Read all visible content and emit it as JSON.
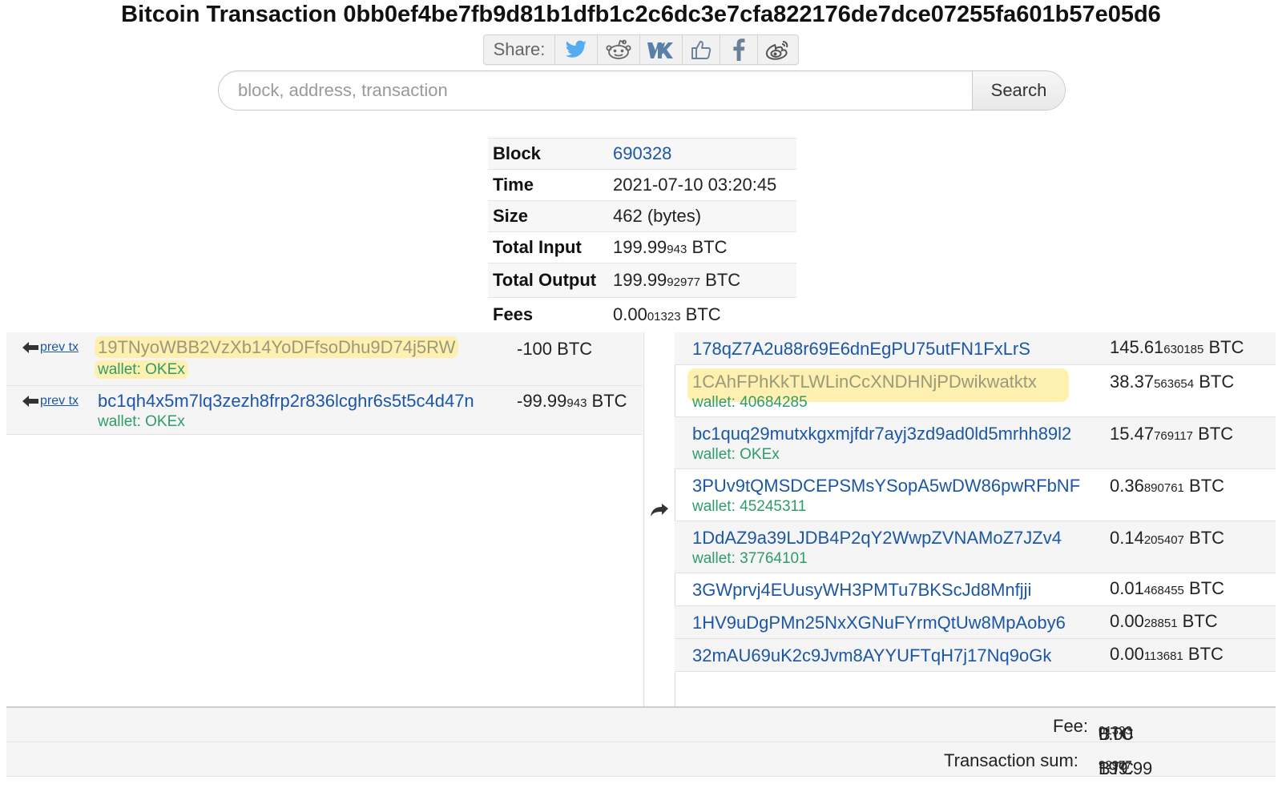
{
  "header": {
    "title": "Bitcoin Transaction 0bb0ef4be7fb9d81b1dfb1c2c6dc3e7cfa822176de7dce07255fa601b57e05d6"
  },
  "share": {
    "label": "Share:",
    "buttons": [
      "twitter-icon",
      "reddit-icon",
      "vk-icon",
      "like-icon",
      "facebook-icon",
      "weibo-icon"
    ]
  },
  "search": {
    "placeholder": "block, address, transaction",
    "button_label": "Search"
  },
  "summary": {
    "block_label": "Block",
    "block_value": "690328",
    "time_label": "Time",
    "time_value": "2021-07-10 03:20:45",
    "size_label": "Size",
    "size_value": "462 (bytes)",
    "total_input_label": "Total Input",
    "total_input_main": "199.99",
    "total_input_small": "943",
    "total_output_label": "Total Output",
    "total_output_main": "199.99",
    "total_output_small": "92977",
    "fees_label": "Fees",
    "fees_main": "0.00",
    "fees_small": "01323",
    "unit": "BTC"
  },
  "inputs": [
    {
      "prev_label": "prev tx",
      "address": "19TNyoWBB2VzXb14YoDFfsoDhu9D74j5RW",
      "wallet": "wallet: OKEx",
      "amount_main": "-100",
      "amount_small": "",
      "unit": "BTC"
    },
    {
      "prev_label": "prev tx",
      "address": "bc1qh4x5m7lq3zezh8frp2r836lcghr6s5t5c4d47n",
      "wallet": "wallet: OKEx",
      "amount_main": "-99.99",
      "amount_small": "943",
      "unit": "BTC"
    }
  ],
  "outputs": [
    {
      "address": "178qZ7A2u88r69E6dnEgPU75utFN1FxLrS",
      "wallet": "",
      "amount_main": "145.61",
      "amount_small": "630185",
      "unit": "BTC"
    },
    {
      "address": "1CAhFPhKkTLWLinCcXNDHNjPDwikwatktx",
      "wallet": "wallet: 40684285",
      "amount_main": "38.37",
      "amount_small": "563654",
      "unit": "BTC"
    },
    {
      "address": "bc1quq29mutxkgxmjfdr7ayj3zd9ad0ld5mrhh89l2",
      "wallet": "wallet: OKEx",
      "amount_main": "15.47",
      "amount_small": "769117",
      "unit": "BTC"
    },
    {
      "address": "3PUv9tQMSDCEPSMsYSopA5wDW86pwRFbNF",
      "wallet": "wallet: 45245311",
      "amount_main": "0.36",
      "amount_small": "890761",
      "unit": "BTC"
    },
    {
      "address": "1DdAZ9a39LJDB4P2qY2WwpZVNAMoZ7JZv4",
      "wallet": "wallet: 37764101",
      "amount_main": "0.14",
      "amount_small": "205407",
      "unit": "BTC"
    },
    {
      "address": "3GWprvj4EUusyWH3PMTu7BKScJd8Mnfjji",
      "wallet": "",
      "amount_main": "0.01",
      "amount_small": "468455",
      "unit": "BTC"
    },
    {
      "address": "1HV9uDgPMn25NxXGNuFYrmQtUw8MpAoby6",
      "wallet": "",
      "amount_main": "0.00",
      "amount_small": "28851",
      "unit": "BTC"
    },
    {
      "address": "32mAU69uK2c9Jvm8AYYUFTqH7j17Nq9oGk",
      "wallet": "",
      "amount_main": "0.00",
      "amount_small": "113681",
      "unit": "BTC"
    }
  ],
  "footer": {
    "fee_label": "Fee:",
    "fee_main": "0.00",
    "fee_small": "01323",
    "sum_label": "Transaction sum:",
    "sum_main": "199.99",
    "sum_small": "92977",
    "unit": "BTC"
  },
  "colors": {
    "link": "#1b56a7",
    "wallet": "#2f9c6a",
    "highlight": "#fdf0b0"
  }
}
